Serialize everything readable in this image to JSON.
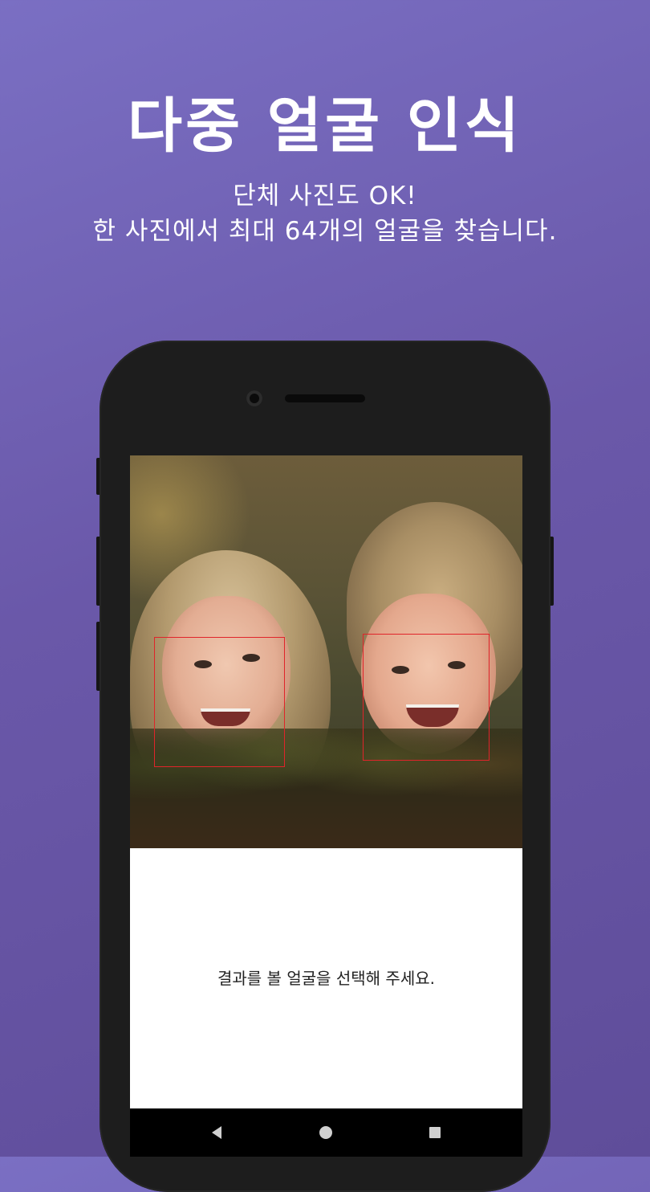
{
  "promo": {
    "title": "다중 얼굴 인식",
    "subtitle_line1": "단체 사진도 OK!",
    "subtitle_line2": "한 사진에서 최대 64개의 얼굴을 찾습니다."
  },
  "app": {
    "prompt": "결과를 볼 얼굴을 선택해 주세요.",
    "detected_faces": 2,
    "face_box_color": "#e0242a"
  },
  "navbar": {
    "icons": [
      "back-triangle-icon",
      "home-circle-icon",
      "recents-square-icon"
    ]
  },
  "colors": {
    "background_top": "#7a6fc3",
    "background_bottom": "#5f4d9a",
    "phone_body": "#1d1d1d"
  }
}
